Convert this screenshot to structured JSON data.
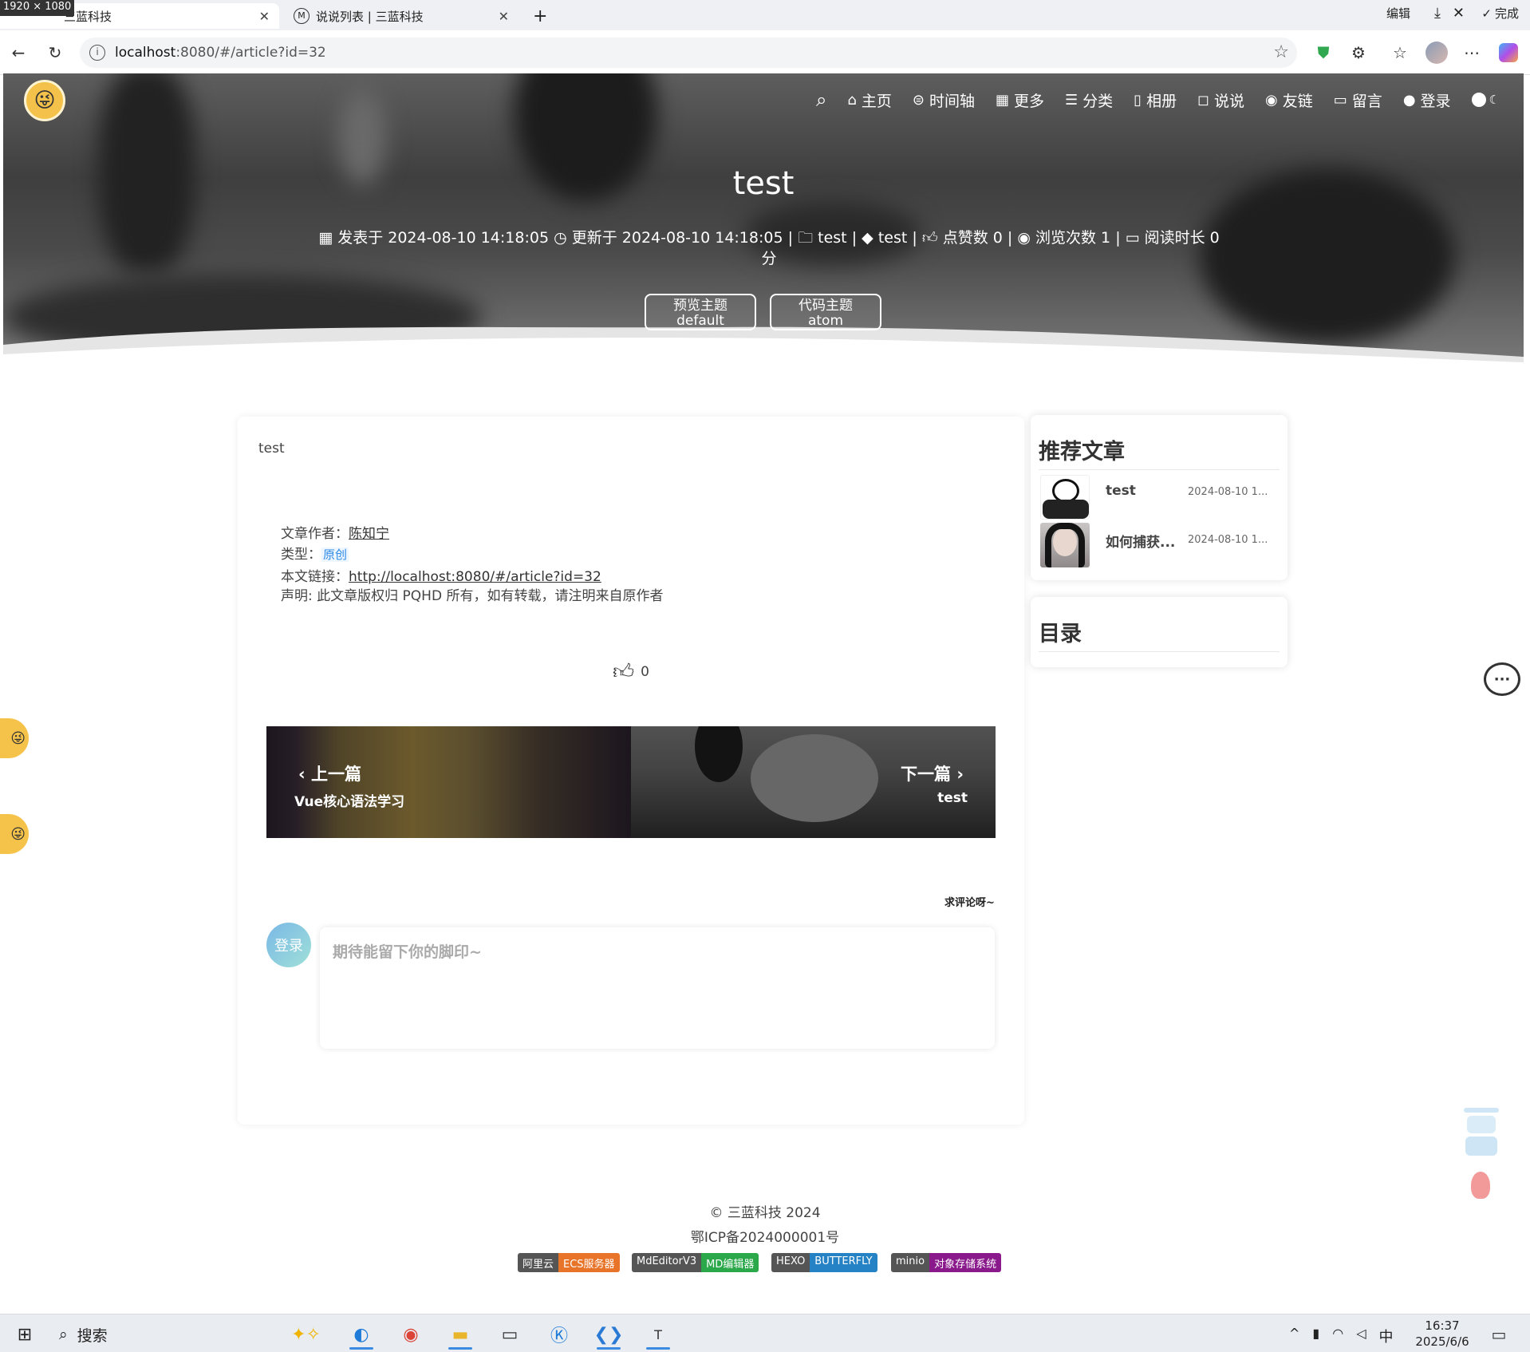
{
  "browser": {
    "resolution_badge": "1920 × 1080",
    "tabs": [
      {
        "label": "三蓝科技",
        "active": true
      },
      {
        "label": "说说列表 | 三蓝科技",
        "active": false
      }
    ],
    "new_tab": "+",
    "url_host": "localhost",
    "url_rest": ":8080/#/article?id=32",
    "top_right": {
      "edit": "编辑",
      "done": "完成"
    }
  },
  "hero": {
    "nav": [
      {
        "icon": "home-icon",
        "label": "主页"
      },
      {
        "icon": "timeline-icon",
        "label": "时间轴"
      },
      {
        "icon": "grid-icon",
        "label": "更多"
      },
      {
        "icon": "list-icon",
        "label": "分类"
      },
      {
        "icon": "document-icon",
        "label": "相册"
      },
      {
        "icon": "chat-icon",
        "label": "说说"
      },
      {
        "icon": "link-icon",
        "label": "友链"
      },
      {
        "icon": "message-icon",
        "label": "留言"
      },
      {
        "icon": "user-icon",
        "label": "登录"
      }
    ],
    "title": "test",
    "meta": {
      "published": "发表于 2024-08-10 14:18:05",
      "updated": "更新于 2024-08-10 14:18:05",
      "category": "test",
      "tag": "test",
      "likes": "点赞数 0",
      "views": "浏览次数 1",
      "reading": "阅读时长 0",
      "reading_unit": "分",
      "sep": "|"
    },
    "theme_buttons": [
      {
        "line1": "预览主题",
        "line2": "default"
      },
      {
        "line1": "代码主题",
        "line2": "atom"
      }
    ]
  },
  "article": {
    "body": "test",
    "author_label": "文章作者：",
    "author": "陈知宁",
    "type_label": "类型：",
    "type": "原创",
    "link_label": "本文链接：",
    "link": "http://localhost:8080/#/article?id=32",
    "statement": "声明: 此文章版权归 PQHD 所有，如有转载，请注明来自原作者",
    "like_count": "0",
    "prev": {
      "label": "上一篇",
      "title": "Vue核心语法学习"
    },
    "next": {
      "label": "下一篇",
      "title": "test"
    },
    "comment_hint": "求评论呀~",
    "comment_avatar": "登录",
    "comment_placeholder": "期待能留下你的脚印~"
  },
  "sidebar": {
    "recommend_title": "推荐文章",
    "recommend": [
      {
        "title": "test",
        "date": "2024-08-10 1..."
      },
      {
        "title": "如何捕获...",
        "date": "2024-08-10 1..."
      }
    ],
    "toc_title": "目录"
  },
  "footer": {
    "copyright": "© 三蓝科技 2024",
    "icp": "鄂ICP备2024000001号",
    "badges": [
      {
        "left": "阿里云",
        "right": "ECS服务器",
        "color": "#e8742a"
      },
      {
        "left": "MdEditorV3",
        "right": "MD编辑器",
        "color": "#2ba84a"
      },
      {
        "left": "HEXO",
        "right": "BUTTERFLY",
        "color": "#2582c4"
      },
      {
        "left": "minio",
        "right": "对象存储系统",
        "color": "#8a1a8c"
      }
    ]
  },
  "taskbar": {
    "search": "搜索",
    "ime": "中",
    "time": "16:37",
    "date": "2025/6/6"
  }
}
